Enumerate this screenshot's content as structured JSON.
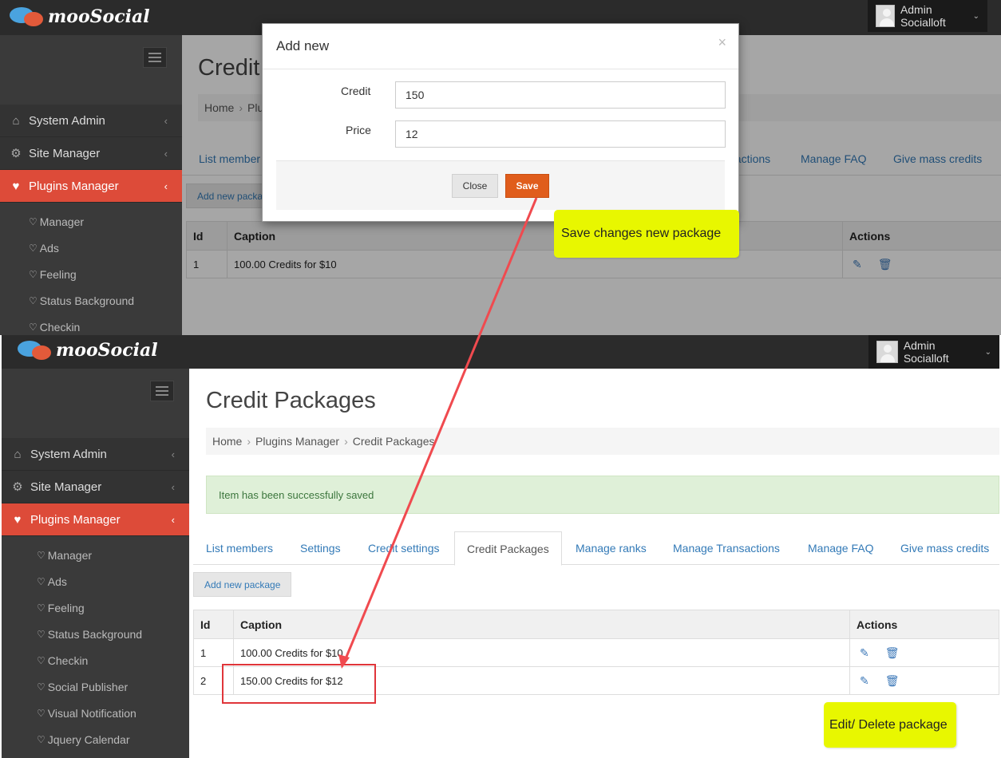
{
  "app": {
    "logo_text": "mooSocial",
    "user_name": "Admin Socialloft",
    "user_caret": "⌄"
  },
  "sidebar": {
    "main_items": [
      {
        "label": "System Admin",
        "icon": "home-icon",
        "glyph": "⌂",
        "chevron": "‹"
      },
      {
        "label": "Site Manager",
        "icon": "gears-icon",
        "glyph": "⚙",
        "chevron": "‹"
      },
      {
        "label": "Plugins Manager",
        "icon": "plug-icon",
        "glyph": "♥",
        "chevron": "‹"
      }
    ],
    "sub_glyph": "♡",
    "sub_items": [
      "Manager",
      "Ads",
      "Feeling",
      "Status Background",
      "Checkin",
      "Social Publisher",
      "Visual Notification",
      "Jquery Calendar"
    ]
  },
  "page": {
    "title": "Credit Packages",
    "top_title_partial": "Credit",
    "top_breadcrumb_partial": {
      "home": "Home",
      "next": "Plu"
    },
    "breadcrumb": [
      "Home",
      "Plugins Manager",
      "Credit Packages"
    ],
    "breadcrumb_sep": "›",
    "alert": "Item has been successfully saved",
    "tabs": [
      "List members",
      "Settings",
      "Credit settings",
      "Credit Packages",
      "Manage ranks",
      "Manage Transactions",
      "Manage FAQ",
      "Give mass credits"
    ],
    "top_tabs_partial": [
      "List member",
      "nsactions",
      "Manage FAQ",
      "Give mass credits"
    ],
    "add_button": "Add new package",
    "top_add_button_partial": "Add new packa",
    "table": {
      "headers": {
        "id": "Id",
        "caption": "Caption",
        "actions": "Actions"
      },
      "rows": [
        {
          "id": "1",
          "caption": "100.00 Credits for $10"
        },
        {
          "id": "2",
          "caption": "150.00 Credits for $12"
        }
      ],
      "edit_glyph": "✎",
      "delete_glyph": "🗑"
    }
  },
  "modal": {
    "title": "Add new",
    "close_x": "×",
    "credit_label": "Credit",
    "credit_value": "150",
    "price_label": "Price",
    "price_value": "12",
    "close_button": "Close",
    "save_button": "Save"
  },
  "annotations": {
    "save_note": "Save changes new package",
    "edit_note": "Edit/ Delete package"
  },
  "colors": {
    "accent_red": "#dd4b39",
    "save_orange": "#e05d1c",
    "link_blue": "#337ab7",
    "note_yellow": "#e8f700",
    "arrow_red": "#e0353a"
  }
}
